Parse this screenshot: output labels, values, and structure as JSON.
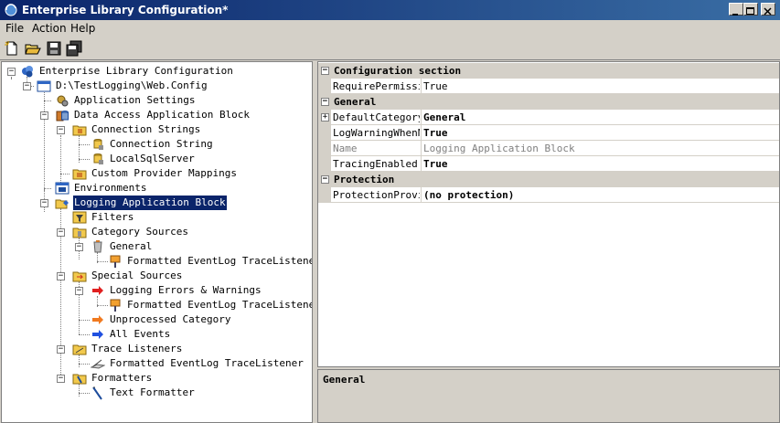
{
  "window": {
    "title": "Enterprise Library Configuration*"
  },
  "menu": [
    "File",
    "Action",
    "Help"
  ],
  "tree": [
    {
      "label": "Enterprise Library Configuration",
      "icon": "library-icon"
    },
    {
      "label": "D:\\TestLogging\\Web.Config",
      "icon": "config-file-icon"
    },
    {
      "label": "Application Settings",
      "icon": "settings-icon"
    },
    {
      "label": "Data Access Application Block",
      "icon": "data-block-icon"
    },
    {
      "label": "Connection Strings",
      "icon": "folder-icon"
    },
    {
      "label": "Connection String",
      "icon": "connection-icon"
    },
    {
      "label": "LocalSqlServer",
      "icon": "connection-icon"
    },
    {
      "label": "Custom Provider Mappings",
      "icon": "folder-icon"
    },
    {
      "label": "Environments",
      "icon": "environments-icon"
    },
    {
      "label": "Logging Application Block",
      "icon": "logging-block-icon"
    },
    {
      "label": "Filters",
      "icon": "filter-icon"
    },
    {
      "label": "Category Sources",
      "icon": "folder-icon"
    },
    {
      "label": "General",
      "icon": "category-icon"
    },
    {
      "label": "Formatted EventLog TraceListener",
      "icon": "listener-ref-icon"
    },
    {
      "label": "Special Sources",
      "icon": "folder-icon"
    },
    {
      "label": "Logging Errors & Warnings",
      "icon": "red-arrow-icon"
    },
    {
      "label": "Formatted EventLog TraceListener",
      "icon": "listener-ref-icon"
    },
    {
      "label": "Unprocessed Category",
      "icon": "orange-arrow-icon"
    },
    {
      "label": "All Events",
      "icon": "blue-arrow-icon"
    },
    {
      "label": "Trace Listeners",
      "icon": "folder-icon"
    },
    {
      "label": "Formatted EventLog TraceListener",
      "icon": "trace-listener-icon"
    },
    {
      "label": "Formatters",
      "icon": "folder-icon"
    },
    {
      "label": "Text Formatter",
      "icon": "formatter-icon"
    }
  ],
  "properties": {
    "categories": [
      "Configuration section",
      "General",
      "Protection"
    ],
    "rows": [
      {
        "name": "RequirePermissio",
        "value": "True"
      },
      {
        "name": "DefaultCategory",
        "value": "General"
      },
      {
        "name": "LogWarningWhenNo",
        "value": "True"
      },
      {
        "name": "Name",
        "value": "Logging Application Block"
      },
      {
        "name": "TracingEnabled",
        "value": "True"
      },
      {
        "name": "ProtectionProvid",
        "value": "(no protection)"
      }
    ]
  },
  "description": {
    "title": "General"
  },
  "colors": {
    "selection": "#0a246a",
    "face": "#d4d0c8",
    "title_start": "#0a246a",
    "title_end": "#3a6ea5"
  }
}
